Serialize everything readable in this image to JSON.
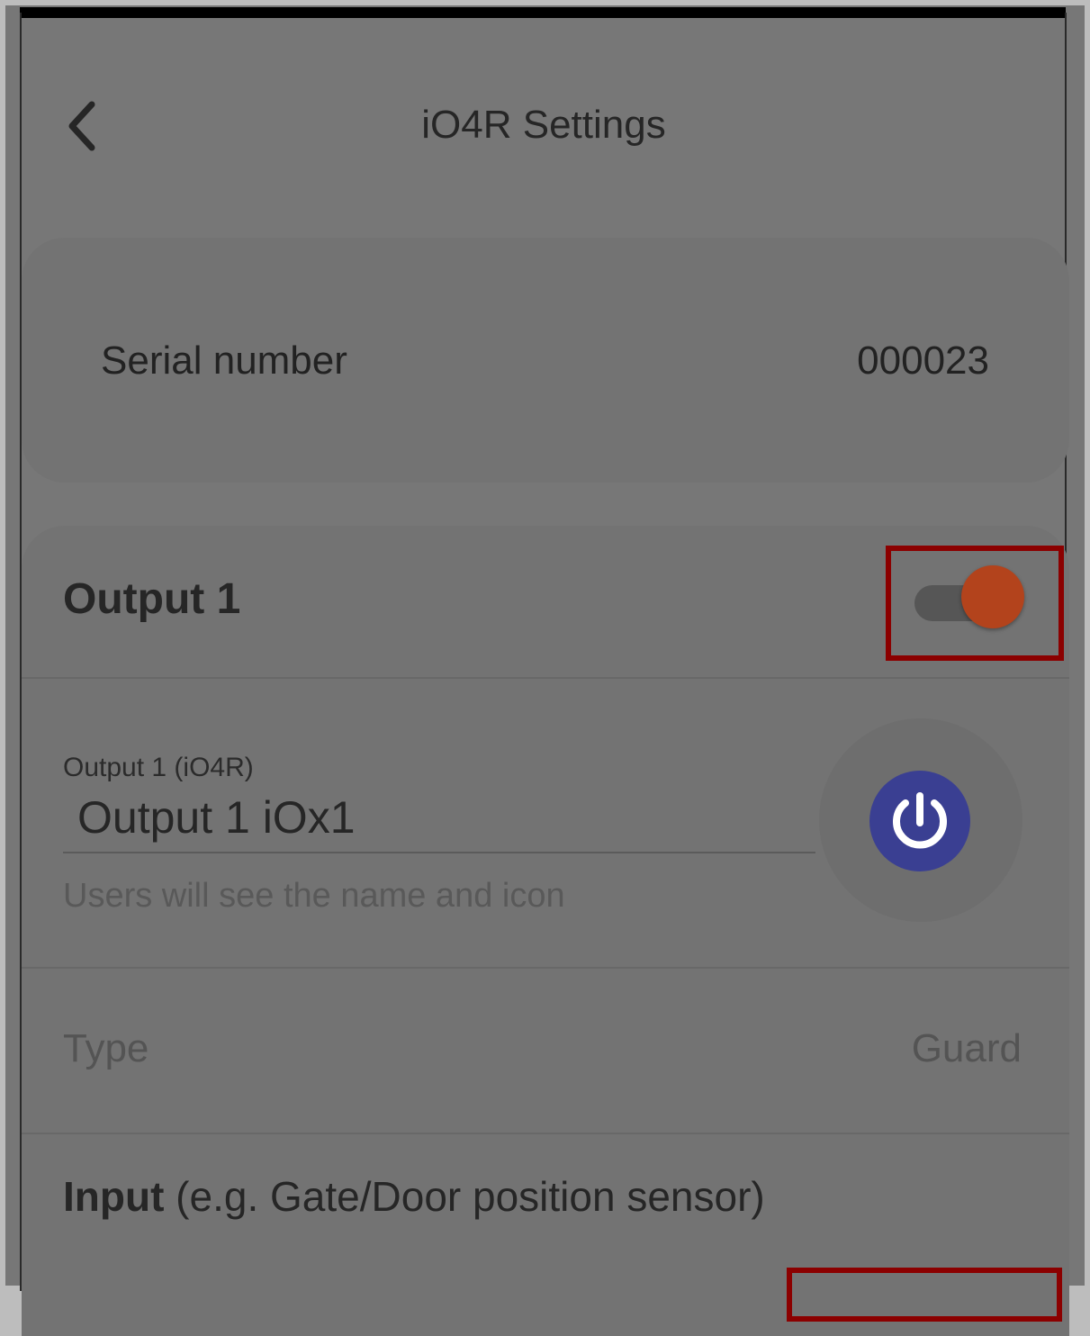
{
  "header": {
    "title": "iO4R Settings",
    "back_icon": "chevron-left-icon"
  },
  "serial": {
    "label": "Serial number",
    "value": "000023"
  },
  "output": {
    "title": "Output 1",
    "enabled": true,
    "field_label": "Output 1 (iO4R)",
    "field_value": "Output 1 iOx1",
    "helper": "Users will see the name and icon",
    "icon": "power-icon",
    "type_label": "Type",
    "type_value": "Guard"
  },
  "input": {
    "title_bold": "Input",
    "title_rest": " (e.g. Gate/Door position sensor)"
  },
  "colors": {
    "switch_knob": "#b3431c",
    "power_icon_bg": "#3a3f92",
    "highlight": "#8b0000"
  }
}
